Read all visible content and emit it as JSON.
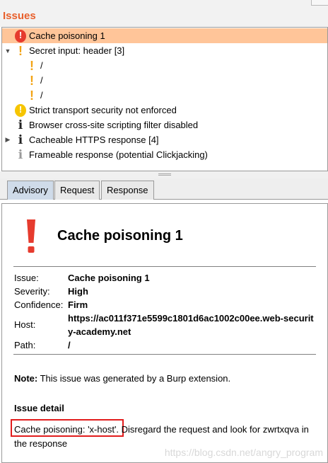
{
  "issues_panel": {
    "title": "Issues",
    "items": [
      {
        "label": "Cache poisoning 1",
        "icon": "exclamation-circle-red-icon",
        "selected": true
      },
      {
        "label": "Secret input: header [3]",
        "icon": "exclamation-orange-icon",
        "expanded": true,
        "children": [
          {
            "label": "/"
          },
          {
            "label": "/"
          },
          {
            "label": "/"
          }
        ]
      },
      {
        "label": "Strict transport security not enforced",
        "icon": "exclamation-circle-yellow-icon"
      },
      {
        "label": "Browser cross-site scripting filter disabled",
        "icon": "info-icon"
      },
      {
        "label": "Cacheable HTTPS response [4]",
        "icon": "info-icon",
        "expanded": false
      },
      {
        "label": "Frameable response (potential Clickjacking)",
        "icon": "info-grey-icon"
      }
    ]
  },
  "tabs": [
    {
      "label": "Advisory",
      "active": true
    },
    {
      "label": "Request",
      "active": false
    },
    {
      "label": "Response",
      "active": false
    }
  ],
  "advisory": {
    "title": "Cache poisoning 1",
    "fields": {
      "issue_label": "Issue:",
      "issue_value": "Cache poisoning 1",
      "severity_label": "Severity:",
      "severity_value": "High",
      "confidence_label": "Confidence:",
      "confidence_value": "Firm",
      "host_label": "Host:",
      "host_value_line1": "https://ac011f371e5599c1801d6ac1002c00ee.web-securit",
      "host_value_line2": "y-academy.net",
      "path_label": "Path:",
      "path_value": "/"
    },
    "note_label": "Note:",
    "note_text": " This issue was generated by a Burp extension.",
    "detail_heading": "Issue detail",
    "detail_highlight": "Cache poisoning: 'x-host'.",
    "detail_rest": " Disregard the request and look for zwrtxqva in the response"
  },
  "watermark": "https://blog.csdn.net/angry_program",
  "colors": {
    "title_orange": "#e8602c",
    "selected_row": "#ffc599",
    "active_tab": "#cfdbe9",
    "high_severity_red": "#e63b2e",
    "highlight_box": "#e21d1d"
  }
}
